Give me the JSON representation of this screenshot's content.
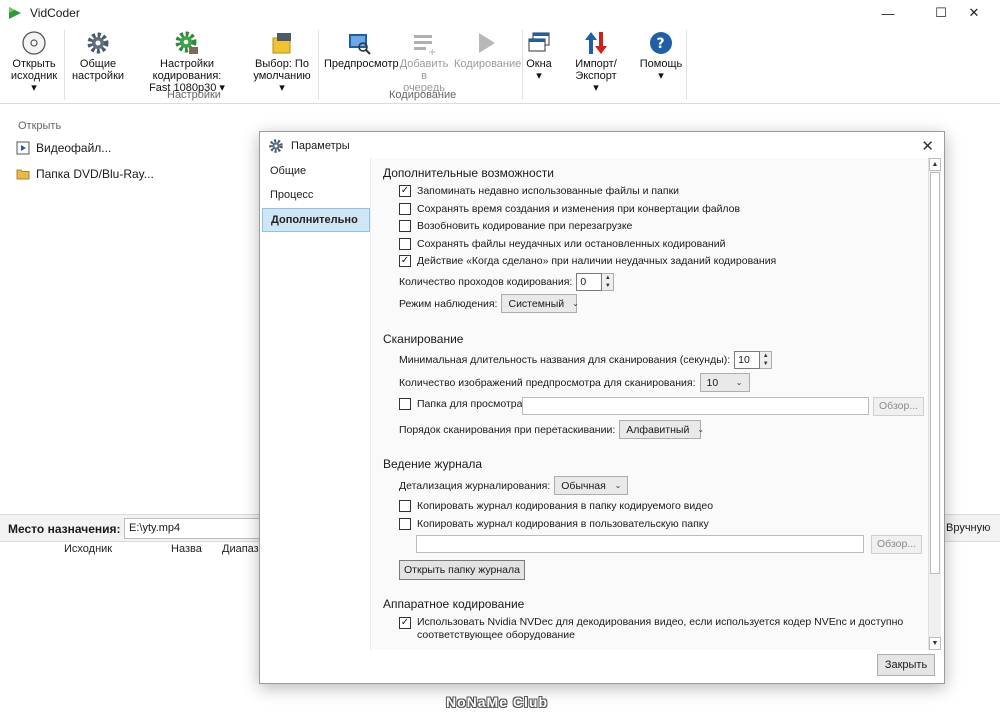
{
  "window": {
    "title": "VidCoder",
    "minimize": "—",
    "maximize": "☐",
    "close": "✕"
  },
  "ribbon": {
    "open_source": [
      "Открыть",
      "исходник ▾"
    ],
    "general_settings": [
      "Общие",
      "настройки"
    ],
    "encoding_settings": [
      "Настройки кодирования:",
      "Fast 1080p30 ▾"
    ],
    "pick_default": [
      "Выбор: По",
      "умолчанию ▾"
    ],
    "preview": [
      "Предпросмотр"
    ],
    "add_to_queue": [
      "Добавить в",
      "очередь"
    ],
    "encode": [
      "Кодирование"
    ],
    "windows": [
      "Окна",
      "▾"
    ],
    "import_export": [
      "Импорт/Экспорт",
      "▾"
    ],
    "help": [
      "Помощь",
      "▾"
    ],
    "group_settings": "Настройки",
    "group_encoding": "Кодирование"
  },
  "open_panel": {
    "label": "Открыть",
    "video_file": "Видеофайл...",
    "dvd_folder": "Папка DVD/Blu-Ray..."
  },
  "destination": {
    "label": "Место назначения:",
    "path": "E:\\yty.mp4",
    "manual": "Вручную"
  },
  "queue_columns": [
    "Исходник",
    "Назва",
    "Диапазо"
  ],
  "watermark": "NoNaMe Club",
  "dialog": {
    "title": "Параметры",
    "close_glyph": "✕",
    "nav": [
      "Общие",
      "Процесс",
      "Дополнительно"
    ],
    "sections": {
      "advanced": "Дополнительные возможности",
      "scanning": "Сканирование",
      "logging": "Ведение журнала",
      "hardware": "Аппаратное кодирование"
    },
    "advanced": {
      "cb_remember": "Запоминать недавно использованные файлы и папки",
      "cb_keep_times": "Сохранять время создания и изменения при конвертации файлов",
      "cb_resume": "Возобновить кодирование при перезагрузке",
      "cb_keep_failed": "Сохранять файлы неудачных или остановленных кодирований",
      "cb_when_done": "Действие «Когда сделано» при наличии неудачных заданий кодирования",
      "passes_label": "Количество проходов кодирования:",
      "passes_value": "0",
      "watch_label": "Режим наблюдения:",
      "watch_value": "Системный"
    },
    "scanning": {
      "min_duration_label": "Минимальная длительность названия для сканирования (секунды):",
      "min_duration_value": "10",
      "preview_count_label": "Количество изображений предпросмотра для сканирования:",
      "preview_count_value": "10",
      "watch_folder_label": "Папка для просмотра:",
      "browse": "Обзор...",
      "drag_order_label": "Порядок сканирования при перетаскивании:",
      "drag_order_value": "Алфавитный"
    },
    "logging": {
      "verbosity_label": "Детализация журналирования:",
      "verbosity_value": "Обычная",
      "cb_copy_to_video": "Копировать журнал кодирования в папку кодируемого видео",
      "cb_copy_to_custom": "Копировать журнал кодирования в пользовательскую папку",
      "browse": "Обзор...",
      "open_log_folder": "Открыть папку журнала"
    },
    "hardware": {
      "cb_nvdec": "Использовать Nvidia NVDec для декодирования видео, если используется кодер NVEnc и доступно",
      "cb_nvdec_line2": "соответствующее оборудование"
    },
    "close_button": "Закрыть"
  }
}
